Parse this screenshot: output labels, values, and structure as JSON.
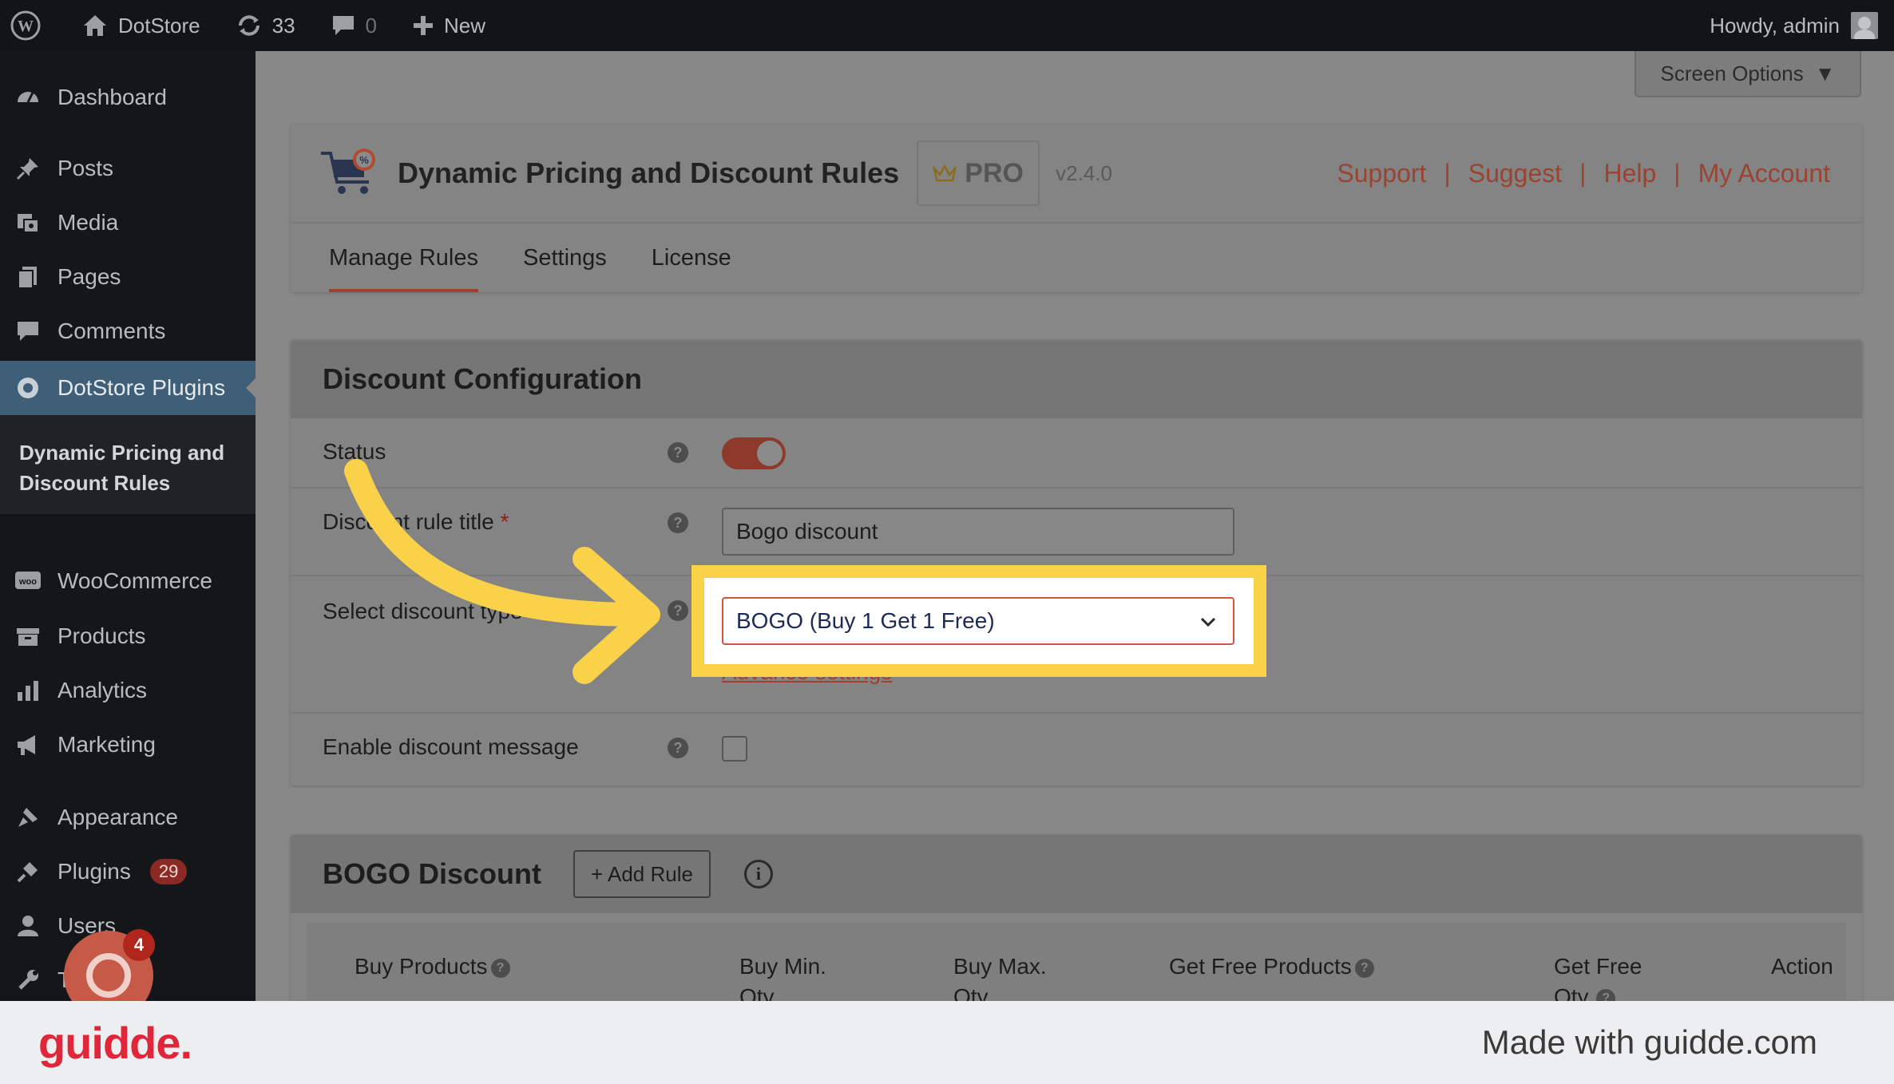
{
  "admin_bar": {
    "site_name": "DotStore",
    "updates_count": "33",
    "comments_count": "0",
    "new_label": "New",
    "greeting": "Howdy, admin"
  },
  "sidebar": {
    "dashboard": "Dashboard",
    "posts": "Posts",
    "media": "Media",
    "pages": "Pages",
    "comments": "Comments",
    "dotstore_plugins": "DotStore Plugins",
    "submenu_item": "Dynamic Pricing and Discount Rules",
    "woocommerce": "WooCommerce",
    "products": "Products",
    "analytics": "Analytics",
    "marketing": "Marketing",
    "appearance": "Appearance",
    "plugins": "Plugins",
    "plugins_badge": "29",
    "users": "Users",
    "tools_partial": "T"
  },
  "screen_options": "Screen Options",
  "plugin_header": {
    "title": "Dynamic Pricing and Discount Rules",
    "pro_label": "PRO",
    "version": "v2.4.0",
    "links": [
      "Support",
      "Suggest",
      "Help",
      "My Account"
    ],
    "separator": "|",
    "tabs": [
      "Manage Rules",
      "Settings",
      "License"
    ]
  },
  "discount_config": {
    "heading": "Discount Configuration",
    "status_label": "Status",
    "rule_title_label": "Discount rule title",
    "required_mark": "*",
    "rule_title_value": "Bogo discount",
    "select_discount_label": "Select discount type",
    "select_discount_value": "BOGO (Buy 1 Get 1 Free)",
    "advance_settings": "Advance settings",
    "enable_message_label": "Enable discount message"
  },
  "bogo": {
    "heading": "BOGO Discount",
    "add_rule": "+ Add Rule",
    "columns": [
      "Buy Products",
      "Buy Min. Qty.",
      "Buy Max. Qty.",
      "Get Free Products",
      "Get Free Qty.",
      "Action"
    ]
  },
  "recorder": {
    "badge": "4"
  },
  "footer": {
    "logo": "guidde.",
    "made_with": "Made with guidde.com"
  },
  "colors": {
    "accent": "#9a4330",
    "highlight": "#f9d24a",
    "select_border": "#d8533c",
    "guidde_red": "#e0263a"
  }
}
